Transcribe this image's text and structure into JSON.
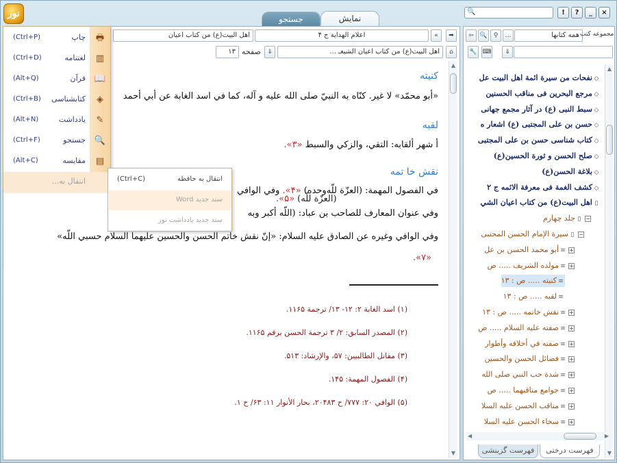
{
  "app": {
    "logo_text": "نور"
  },
  "window_buttons": {
    "close": "×",
    "help": "?",
    "info": "!",
    "minimize": "_"
  },
  "tabs": [
    {
      "label": "نمایش",
      "active": true
    },
    {
      "label": "جستجو",
      "active": false
    }
  ],
  "toolbar": {
    "book_title": "اعلام الهداية ج ۴",
    "book_title_right": "اهل البيت(ع) من كتاب اعيان",
    "breadcrumb": "اهل البيت(ع) من كتاب اعيان الشيعـ ...",
    "page_label": "صفحه",
    "page_value": "۱۳"
  },
  "right_toolbar": {
    "collection_label": "مجموعه کتب",
    "collection_value": "همه کتابها"
  },
  "content": {
    "h1": "كنيته",
    "p1": "«أبو محمّد» لا غير. كنّاه به النبيّ صلى الله عليه و آله، كما في اسد الغابة عن أبي أحمد",
    "h2": "لقبه",
    "p2a": "أ شهر ألقابه: التقي، والزكي والسبط ",
    "p2ref": "«۳».",
    "h3": "نقش خا تمه",
    "p3a": "في الفصول المهمة: (العزّة للّه‌وحده) ",
    "p3ref": "«۴».",
    "p3b": " وفي الوافي",
    "p3c": "(العزّة للّه) ",
    "p3ref2": "«۵».",
    "p4a": "وفي عنوان المعارف للصاحب بن عباد: (اللّه أكبر وبه",
    "p5a": "وفي الوافي وغيره عن الصادق عليه السلام: «إنّ نقش خاتم الحسن والحسين عليهما السلام حسبي اللّه»",
    "p5ref": "«۷».",
    "footnotes": [
      "(۱) اسد الغابة ۲: ۱۲- ۱۳/ ترجمة ۱۱۶۵.",
      "(۲) المصدر السابق: ۲/ ۳ ترجمة الحسن برقم ۱۱۶۵.",
      "(۳) مقاتل الطالبيين: ۵۷، والإرشاد: ۵۱۳.",
      "(۴) الفصول المهمة: ۱۴۵.",
      "(۵) الوافي ۲۰: ۷۷۷/ ح ۲۰۴۸۳، بحار الأنوار ۱۱: ۶۳/ ح ۱."
    ]
  },
  "menu": {
    "items": [
      {
        "label": "چاپ",
        "shortcut": "(Ctrl+P)",
        "icon": "printer-icon",
        "glyph": "🖶"
      },
      {
        "label": "لغتنامه",
        "shortcut": "(Ctrl+D)",
        "icon": "dictionary-icon",
        "glyph": "▥"
      },
      {
        "label": "قرآن",
        "shortcut": "(Alt+Q)",
        "icon": "quran-icon",
        "glyph": "📖"
      },
      {
        "label": "کتابشناسی",
        "shortcut": "(Ctrl+B)",
        "icon": "bibliography-icon",
        "glyph": "◈"
      },
      {
        "label": "یادداشت",
        "shortcut": "(Alt+N)",
        "icon": "note-icon",
        "glyph": "✎"
      },
      {
        "label": "جستجو",
        "shortcut": "(Ctrl+F)",
        "icon": "search-icon",
        "glyph": "🔍"
      },
      {
        "label": "مقایسه",
        "shortcut": "(Alt+C)",
        "icon": "compare-icon",
        "glyph": "▤"
      },
      {
        "label": "انتقال به...",
        "shortcut": "",
        "icon": "",
        "glyph": ""
      }
    ],
    "submenu": [
      {
        "label": "انتقال به حافظه",
        "shortcut": "(Ctrl+C)"
      },
      {
        "label": "سند جديد Word",
        "shortcut": ""
      },
      {
        "label": "سند جديد يادداشت نور",
        "shortcut": ""
      }
    ]
  },
  "tree": {
    "items": [
      {
        "label": "نفحات من سيرة ائمة اهل البيت عل",
        "icon": "book-icon",
        "glyph": "◇",
        "level": 0
      },
      {
        "label": "مرجع البحرين فى مناقب الحسنين",
        "icon": "book-icon",
        "glyph": "◇",
        "level": 0
      },
      {
        "label": "سبط النبى (ع) در آثار مجمع جهانى",
        "icon": "book-icon",
        "glyph": "◇",
        "level": 0
      },
      {
        "label": "حسن بن على المجتبى (ع) اشعار ه",
        "icon": "book-icon",
        "glyph": "◇",
        "level": 0
      },
      {
        "label": "كتاب شناسى حسن بن على المجتبى",
        "icon": "book-icon",
        "glyph": "◇",
        "level": 0
      },
      {
        "label": "صلح الحسن و ثورة الحسين(ع)",
        "icon": "book-icon",
        "glyph": "◇",
        "level": 0
      },
      {
        "label": "بلاغة الحسن(ع)",
        "icon": "book-icon",
        "glyph": "◇",
        "level": 0
      },
      {
        "label": "كشف الغمة فى معرفة الائمه ج ۲",
        "icon": "book-icon",
        "glyph": "◇",
        "level": 0
      },
      {
        "label": "اهل البيت(ع) من كتاب اعيان الشي",
        "icon": "open-book-icon",
        "glyph": "▯",
        "level": 0
      },
      {
        "label": "جلد چهارم",
        "icon": "volume-icon",
        "glyph": "▯",
        "level": 1
      },
      {
        "label": "سيرة الإمام الحسن المجتبى",
        "icon": "chapter-icon",
        "glyph": "▯",
        "level": 2
      },
      {
        "label": "أبو محمد الحسن بن عل",
        "icon": "page-icon",
        "glyph": "≡",
        "level": 3
      },
      {
        "label": "مولده الشريف ..... ص",
        "icon": "page-icon",
        "glyph": "≡",
        "level": 3
      },
      {
        "label": "كنيته ..... ص : ۱۳",
        "icon": "page-icon",
        "glyph": "≡",
        "level": 4,
        "selected": true
      },
      {
        "label": "لقبه ..... ص : ۱۳",
        "icon": "page-icon",
        "glyph": "≡",
        "level": 4
      },
      {
        "label": "نقش خاتمه ..... ص : ۱۳",
        "icon": "page-icon",
        "glyph": "≡",
        "level": 3
      },
      {
        "label": "صفته عليه السلام ..... ص",
        "icon": "page-icon",
        "glyph": "≡",
        "level": 3
      },
      {
        "label": "صفته في أخلاقه وأطوار",
        "icon": "page-icon",
        "glyph": "≡",
        "level": 3
      },
      {
        "label": "فضائل الحسن والحسين",
        "icon": "page-icon",
        "glyph": "≡",
        "level": 3
      },
      {
        "label": "شدة حب النبي صلى الله",
        "icon": "page-icon",
        "glyph": "≡",
        "level": 3
      },
      {
        "label": "جوامع مناقبهما ..... ص",
        "icon": "page-icon",
        "glyph": "≡",
        "level": 3
      },
      {
        "label": "مناقب الحسن عليه السلا",
        "icon": "page-icon",
        "glyph": "≡",
        "level": 3
      },
      {
        "label": "سخاء الحسن عليه السلا",
        "icon": "page-icon",
        "glyph": "≡",
        "level": 3
      }
    ]
  },
  "bottom_tabs": [
    {
      "label": "فهرست درختی",
      "active": true
    },
    {
      "label": "فهرست گزینشی",
      "active": false
    }
  ]
}
